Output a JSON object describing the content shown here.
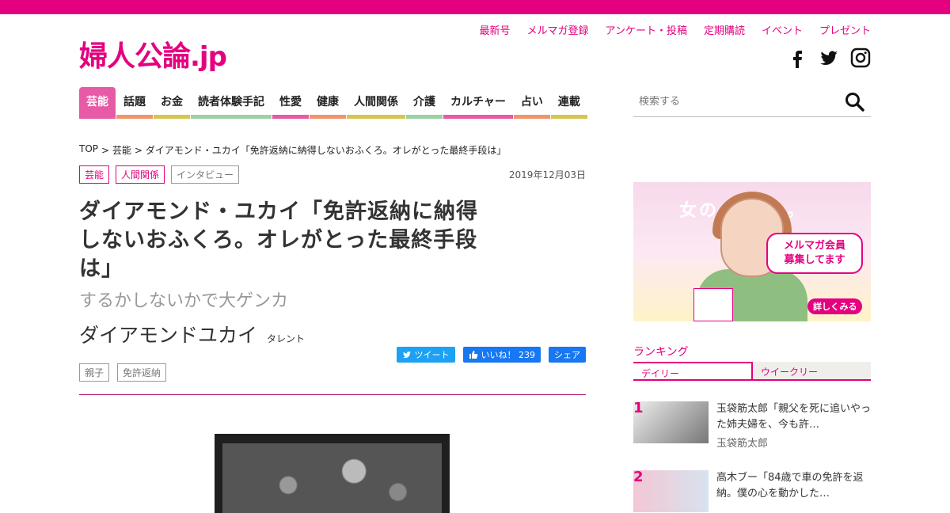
{
  "top_links": [
    "最新号",
    "メルマガ登録",
    "アンケート・投稿",
    "定期購読",
    "イベント",
    "プレゼント"
  ],
  "logo": {
    "text": "婦人公論",
    "suffix": ".jp"
  },
  "social": [
    "facebook-icon",
    "twitter-icon",
    "instagram-icon"
  ],
  "nav": [
    {
      "label": "芸能",
      "color": "#e65aa6"
    },
    {
      "label": "話題",
      "color": "#f0956b"
    },
    {
      "label": "お金",
      "color": "#d7c54f"
    },
    {
      "label": "読者体験手記",
      "color": "#99d3a5"
    },
    {
      "label": "性愛",
      "color": "#e65aa6"
    },
    {
      "label": "健康",
      "color": "#f0956b"
    },
    {
      "label": "人間関係",
      "color": "#d7c54f"
    },
    {
      "label": "介護",
      "color": "#99d3a5"
    },
    {
      "label": "カルチャー",
      "color": "#e65aa6"
    },
    {
      "label": "占い",
      "color": "#f0956b"
    },
    {
      "label": "連載",
      "color": "#d7c54f"
    }
  ],
  "search": {
    "placeholder": "検索する"
  },
  "breadcrumb": [
    "TOP",
    "> 芸能",
    "> ダイアモンド・ユカイ「免許返納に納得しないおふくろ。オレがとった最終手段は」"
  ],
  "tags": [
    "芸能",
    "人間関係",
    "インタビュー"
  ],
  "date": "2019年12月03日",
  "article": {
    "title": "ダイアモンド・ユカイ「免許返納に納得しないおふくろ。オレがとった最終手段は」",
    "subtitle": "するかしないかで大ゲンカ",
    "author": "ダイアモンドユカイ",
    "author_role": "タレント"
  },
  "share": {
    "tweet": "ツイート",
    "like": "いいね！ 239",
    "share": "シェア"
  },
  "keyword_tags": [
    "親子",
    "免許返納"
  ],
  "banner": {
    "bg_text": "女の 輝きを。",
    "bubble1": "メルマガ会員",
    "bubble2": "募集してます",
    "more": "詳しくみる"
  },
  "ranking": {
    "title": "ランキング",
    "tabs": [
      "デイリー",
      "ウイークリー"
    ],
    "items": [
      {
        "num": "1",
        "text": "玉袋筋太郎「親父を死に追いやった姉夫婦を、今も許…",
        "author": "玉袋筋太郎"
      },
      {
        "num": "2",
        "text": "高木ブー「84歳で車の免許を返納。僕の心を動かした…",
        "author": ""
      }
    ]
  },
  "colors": {
    "accent": "#e4007f"
  }
}
